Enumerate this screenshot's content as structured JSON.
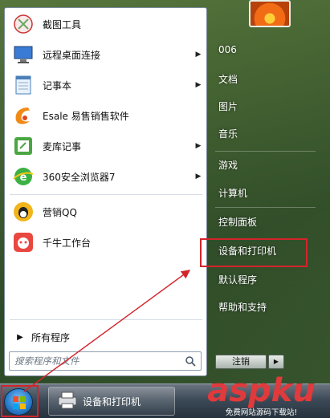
{
  "programs": [
    {
      "label": "截图工具",
      "has_submenu": false,
      "icon": "scissors-icon"
    },
    {
      "label": "远程桌面连接",
      "has_submenu": true,
      "icon": "remote-desktop-icon"
    },
    {
      "label": "记事本",
      "has_submenu": true,
      "icon": "notepad-icon"
    },
    {
      "label": "Esale 易售销售软件",
      "has_submenu": false,
      "icon": "esale-icon"
    },
    {
      "label": "麦库记事",
      "has_submenu": true,
      "icon": "memo-icon"
    },
    {
      "label": "360安全浏览器7",
      "has_submenu": true,
      "icon": "browser-360-icon"
    },
    {
      "label": "营销QQ",
      "has_submenu": false,
      "icon": "qq-icon"
    },
    {
      "label": "千牛工作台",
      "has_submenu": false,
      "icon": "qianniu-icon"
    }
  ],
  "all_programs_label": "所有程序",
  "search_placeholder": "搜索程序和文件",
  "right_items": [
    {
      "label": "006"
    },
    {
      "label": "文档"
    },
    {
      "label": "图片"
    },
    {
      "label": "音乐"
    },
    {
      "label": "游戏"
    },
    {
      "label": "计算机"
    },
    {
      "label": "控制面板"
    },
    {
      "label": "设备和打印机"
    },
    {
      "label": "默认程序"
    },
    {
      "label": "帮助和支持"
    }
  ],
  "shutdown_label": "注销",
  "taskbar": {
    "window_label": "设备和打印机"
  },
  "watermark": {
    "logo_a": "asp",
    "logo_b": "ku",
    "subtitle": "免费网站源码下载站!"
  },
  "colors": {
    "highlight": "#d3242b",
    "accent": "#2b7fcf"
  }
}
